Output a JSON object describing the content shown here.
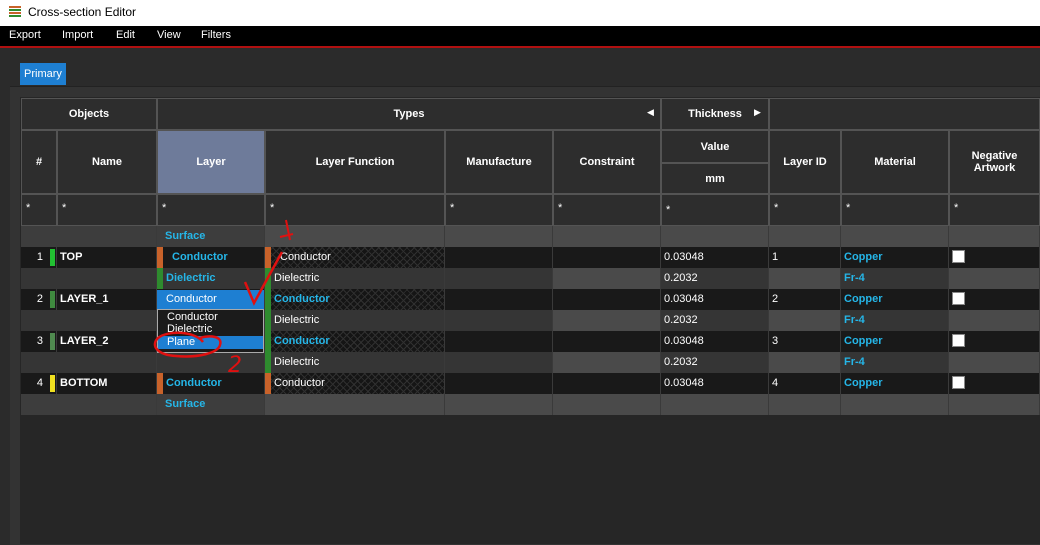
{
  "window": {
    "title": "Cross-section Editor"
  },
  "menu": [
    "Export",
    "Import",
    "Edit",
    "View",
    "Filters"
  ],
  "tabs": [
    {
      "label": "Primary",
      "active": true
    }
  ],
  "groups": {
    "objects": "Objects",
    "types": "Types",
    "thickness": "Thickness"
  },
  "columns": {
    "num": "#",
    "name": "Name",
    "layer": "Layer",
    "function": "Layer Function",
    "manufacture": "Manufacture",
    "constraint": "Constraint",
    "value": "Value",
    "unit": "mm",
    "layer_id": "Layer ID",
    "material": "Material",
    "negative": "Negative Artwork"
  },
  "filters": [
    "*",
    "*",
    "*",
    "*",
    "*",
    "*",
    "*",
    "*",
    "*",
    "*"
  ],
  "rows": [
    {
      "kind": "surface",
      "layer": "Surface"
    },
    {
      "kind": "conductor",
      "num": "1",
      "name": "TOP",
      "layer": "Conductor",
      "function": "Conductor",
      "thickness": "0.03048",
      "layer_id": "1",
      "material": "Copper",
      "marker": "#22c032"
    },
    {
      "kind": "dielectric",
      "layer": "Dielectric",
      "function": "Dielectric",
      "thickness": "0.2032",
      "material": "Fr-4"
    },
    {
      "kind": "conductor",
      "num": "2",
      "name": "LAYER_1",
      "layer": "Conductor",
      "function": "Conductor",
      "thickness": "0.03048",
      "layer_id": "2",
      "material": "Copper",
      "marker": "#3f8a3f"
    },
    {
      "kind": "dielectric",
      "layer": "Dielectric",
      "function": "Dielectric",
      "thickness": "0.2032",
      "material": "Fr-4"
    },
    {
      "kind": "conductor",
      "num": "3",
      "name": "LAYER_2",
      "layer": "Conductor",
      "function": "Conductor",
      "thickness": "0.03048",
      "layer_id": "3",
      "material": "Copper",
      "marker": "#4f8a4f"
    },
    {
      "kind": "dielectric",
      "layer": "Dielectric",
      "function": "Dielectric",
      "thickness": "0.2032",
      "material": "Fr-4"
    },
    {
      "kind": "conductor",
      "num": "4",
      "name": "BOTTOM",
      "layer": "Conductor",
      "function": "Conductor",
      "thickness": "0.03048",
      "layer_id": "4",
      "material": "Copper",
      "marker": "#f0e020"
    },
    {
      "kind": "surface",
      "layer": "Surface"
    }
  ],
  "dropdown": {
    "value": "Conductor",
    "options": [
      "Conductor",
      "Dielectric",
      "Plane"
    ],
    "selected": "Plane"
  },
  "annotations": {
    "number_mark": "2"
  },
  "colors": {
    "accent": "#1e7fd2",
    "cyan": "#25b6e8",
    "conductor": "#c8622a",
    "dielectric": "#2e8b2e",
    "annotation": "#e01010"
  }
}
